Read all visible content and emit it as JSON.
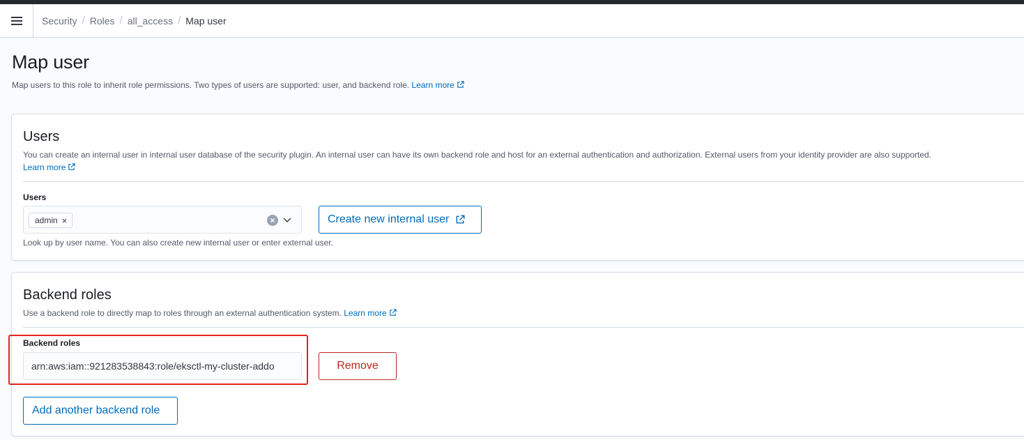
{
  "header": {
    "menu_icon": "hamburger-menu-icon",
    "breadcrumbs": [
      "Security",
      "Roles",
      "all_access",
      "Map user"
    ],
    "separator": "/"
  },
  "page": {
    "title": "Map user",
    "description": "Map users to this role to inherit role permissions. Two types of users are supported: user, and backend role.",
    "learn_more": "Learn more"
  },
  "users_panel": {
    "title": "Users",
    "description": "You can create an internal user in internal user database of the security plugin. An internal user can have its own backend role and host for an external authentication and authorization. External users from your identity provider are also supported.",
    "learn_more": "Learn more",
    "field_label": "Users",
    "selected": [
      "admin"
    ],
    "help_text": "Look up by user name. You can also create new internal user or enter external user.",
    "create_button": "Create new internal user"
  },
  "backend_panel": {
    "title": "Backend roles",
    "description": "Use a backend role to directly map to roles through an external authentication system.",
    "learn_more": "Learn more",
    "field_label": "Backend roles",
    "value": "arn:aws:iam::921283538843:role/eksctl-my-cluster-addo",
    "remove_button": "Remove",
    "add_button": "Add another backend role"
  },
  "colors": {
    "link": "#006bb8",
    "danger": "#bd271e",
    "highlight": "#e4231b"
  }
}
